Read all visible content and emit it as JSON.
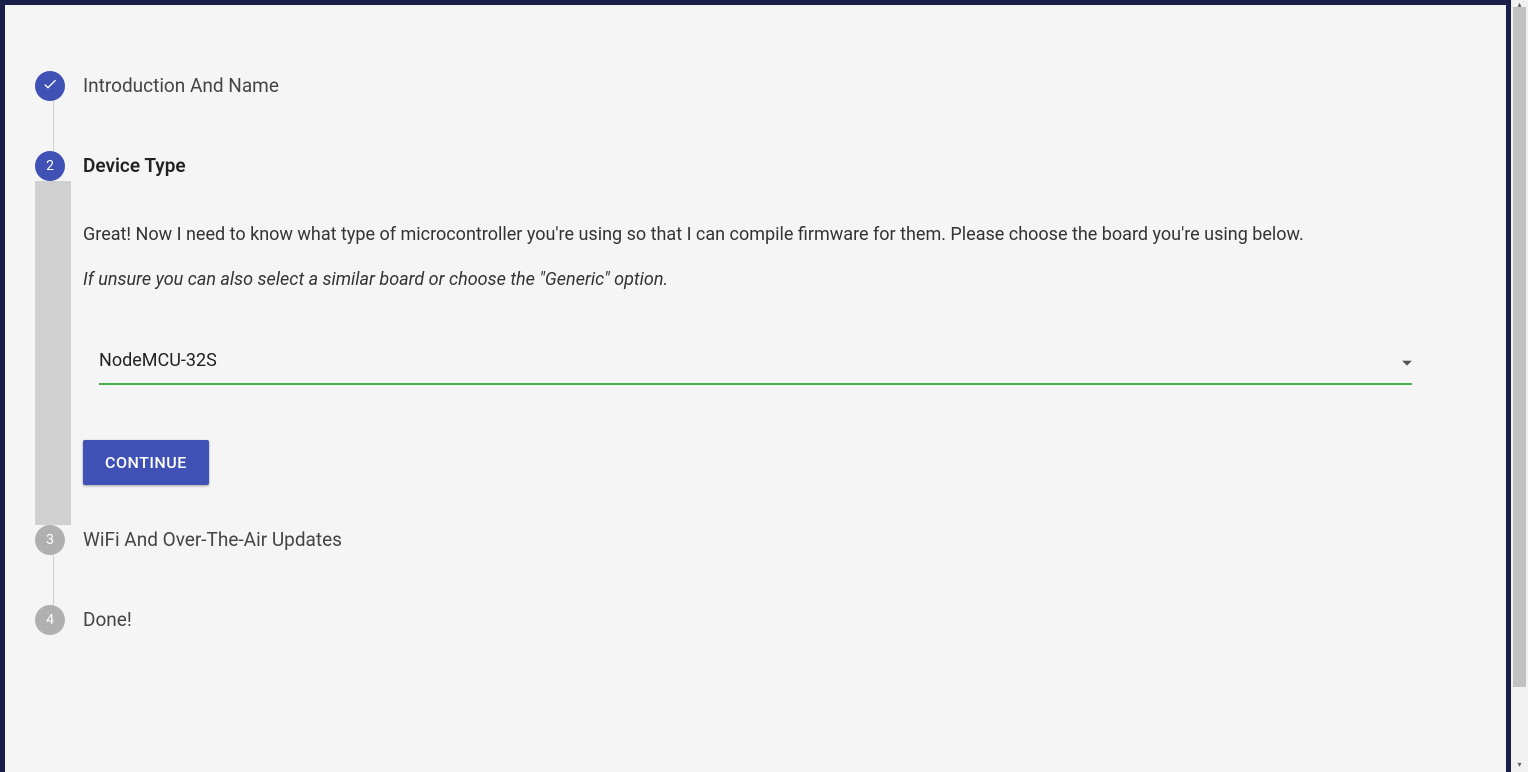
{
  "steps": {
    "step1": {
      "label": "Introduction And Name",
      "status": "completed"
    },
    "step2": {
      "label": "Device Type",
      "number": "2",
      "status": "active",
      "description": "Great! Now I need to know what type of microcontroller you're using so that I can compile firmware for them. Please choose the board you're using below.",
      "hint": "If unsure you can also select a similar board or choose the \"Generic\" option.",
      "select_value": "NodeMCU-32S",
      "continue_label": "CONTINUE"
    },
    "step3": {
      "label": "WiFi And Over-The-Air Updates",
      "number": "3",
      "status": "inactive"
    },
    "step4": {
      "label": "Done!",
      "number": "4",
      "status": "inactive"
    }
  }
}
